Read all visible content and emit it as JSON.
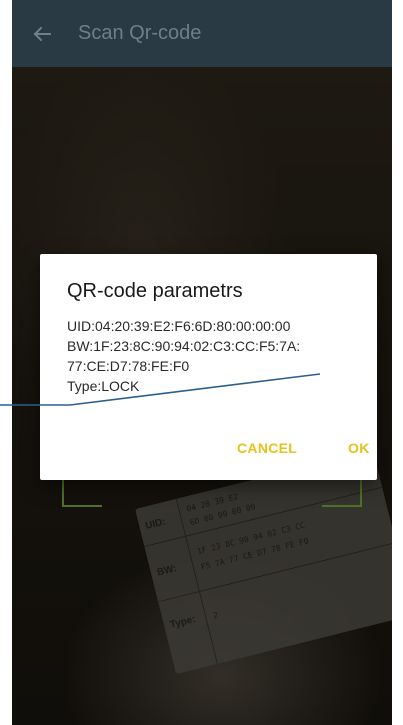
{
  "app_bar": {
    "back_icon": "arrow-left-icon",
    "title": "Scan Qr-code"
  },
  "camera_label": {
    "uid_key": "UID:",
    "uid_line1": "04 20 39 E2",
    "uid_line2": "6D 80 00 00 00",
    "bw_key": "BW:",
    "bw_line1": "1F 23 8C 90 94 02 C3 CC",
    "bw_line2": "F5 7A 77 CE D7 78 FE F0",
    "type_key": "Type:",
    "type_value": "2"
  },
  "dialog": {
    "title": "QR-code parametrs",
    "uid": "UID:04:20:39:E2:F6:6D:80:00:00:00",
    "bw_line1": "BW:1F:23:8C:90:94:02:C3:CC:F5:7A:",
    "bw_line2": "77:CE:D7:78:FE:F0",
    "type": "Type:LOCK",
    "cancel_label": "CANCEL",
    "ok_label": "OK"
  },
  "colors": {
    "app_bar": "#2a3a45",
    "accent": "#e6c21a",
    "scan_frame": "#7cae3c",
    "annotation_line": "#2b5f8e"
  }
}
